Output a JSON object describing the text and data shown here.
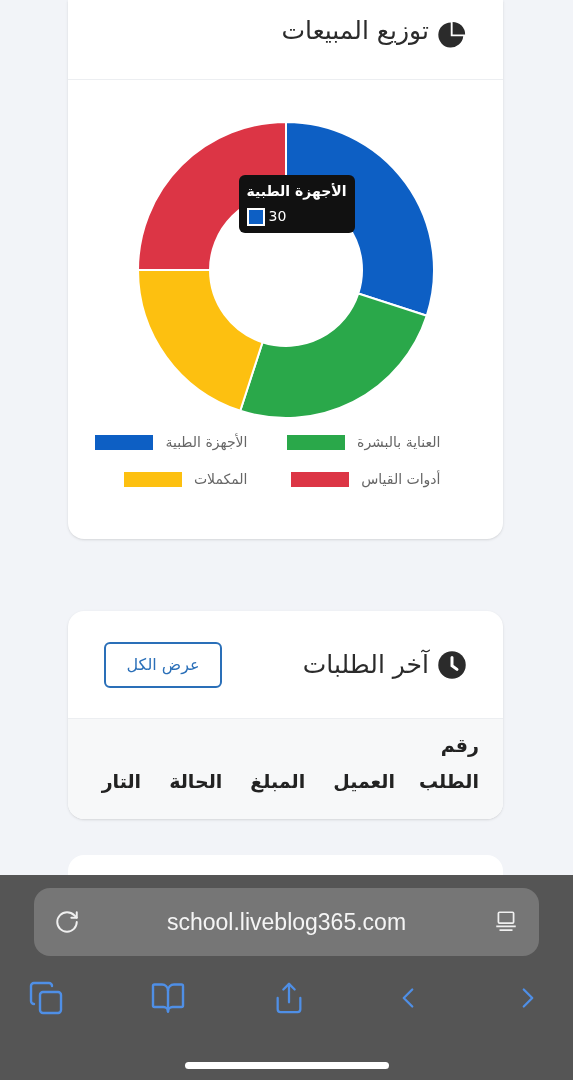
{
  "sales_card": {
    "title": "توزيع المبيعات",
    "chart_data": {
      "type": "donut",
      "categories": [
        "الأجهزة الطبية",
        "العناية بالبشرة",
        "المكملات",
        "أدوات القياس"
      ],
      "values": [
        30,
        25,
        20,
        25
      ],
      "colors": [
        "#0d5fc4",
        "#2aa84a",
        "#fdc010",
        "#dc3545"
      ]
    },
    "tooltip": {
      "title": "الأجهزة الطبية",
      "value": "30"
    }
  },
  "orders_card": {
    "title": "آخر الطلبات",
    "button": "عرض الكل",
    "columns": [
      "رقم الطلب",
      "العميل",
      "المبلغ",
      "الحالة",
      "التار"
    ]
  },
  "browser": {
    "url": "school.liveblog365.com"
  }
}
